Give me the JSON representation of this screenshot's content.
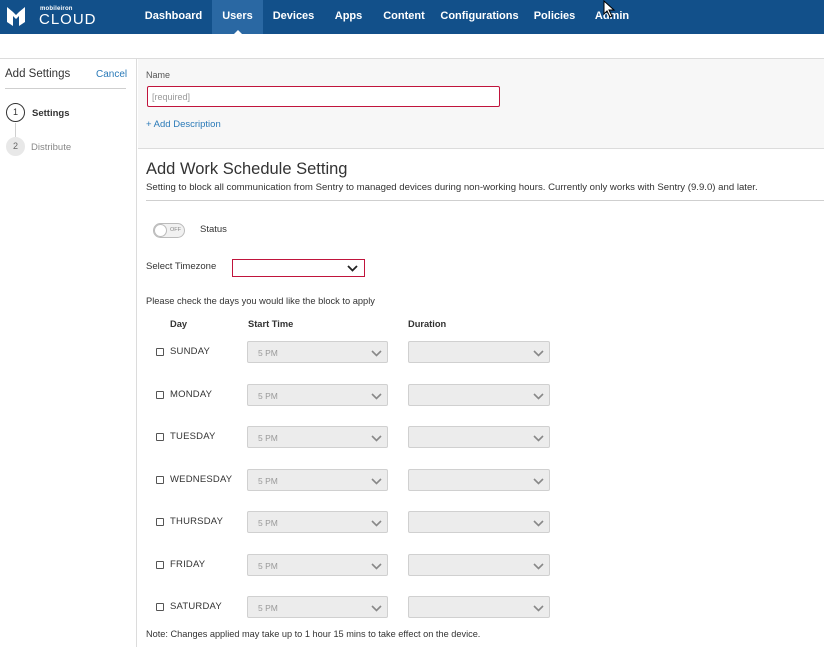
{
  "brand": {
    "small": "mobileiron",
    "big": "CLOUD"
  },
  "nav": [
    {
      "label": "Dashboard",
      "active": false
    },
    {
      "label": "Users",
      "active": true
    },
    {
      "label": "Devices",
      "active": false
    },
    {
      "label": "Apps",
      "active": false
    },
    {
      "label": "Content",
      "active": false
    },
    {
      "label": "Configurations",
      "active": false
    },
    {
      "label": "Policies",
      "active": false
    },
    {
      "label": "Admin",
      "active": false
    }
  ],
  "left": {
    "title": "Add Settings",
    "cancel": "Cancel",
    "steps": [
      {
        "number": "1",
        "label": "Settings"
      },
      {
        "number": "2",
        "label": "Distribute"
      }
    ]
  },
  "name": {
    "label": "Name",
    "placeholder": "[required]",
    "value": "",
    "add_description": "+ Add Description"
  },
  "section": {
    "title": "Add Work Schedule Setting",
    "description": "Setting to block all communication from Sentry to managed devices during non-working hours. Currently only works with Sentry (9.9.0) and later.",
    "status_label": "Status",
    "toggle_text": "OFF",
    "timezone_label": "Select Timezone",
    "timezone_value": "",
    "instructions": "Please check the days you would like the block to apply",
    "columns": {
      "day": "Day",
      "start": "Start Time",
      "duration": "Duration"
    },
    "days": [
      {
        "name": "SUNDAY",
        "checked": false,
        "start": "5 PM",
        "duration": ""
      },
      {
        "name": "MONDAY",
        "checked": false,
        "start": "5 PM",
        "duration": ""
      },
      {
        "name": "TUESDAY",
        "checked": false,
        "start": "5 PM",
        "duration": ""
      },
      {
        "name": "WEDNESDAY",
        "checked": false,
        "start": "5 PM",
        "duration": ""
      },
      {
        "name": "THURSDAY",
        "checked": false,
        "start": "5 PM",
        "duration": ""
      },
      {
        "name": "FRIDAY",
        "checked": false,
        "start": "5 PM",
        "duration": ""
      },
      {
        "name": "SATURDAY",
        "checked": false,
        "start": "5 PM",
        "duration": ""
      }
    ],
    "note": "Note: Changes applied may take up to 1 hour 15 mins to take effect on the device."
  },
  "colors": {
    "nav_bg": "#12508a",
    "nav_active": "#2a68a3",
    "link": "#2a7ab8",
    "required_border": "#c0143c"
  },
  "icons": {
    "logo": "mobileiron-logo-icon",
    "chevron": "chevron-down-icon",
    "cursor": "mouse-pointer-icon"
  }
}
